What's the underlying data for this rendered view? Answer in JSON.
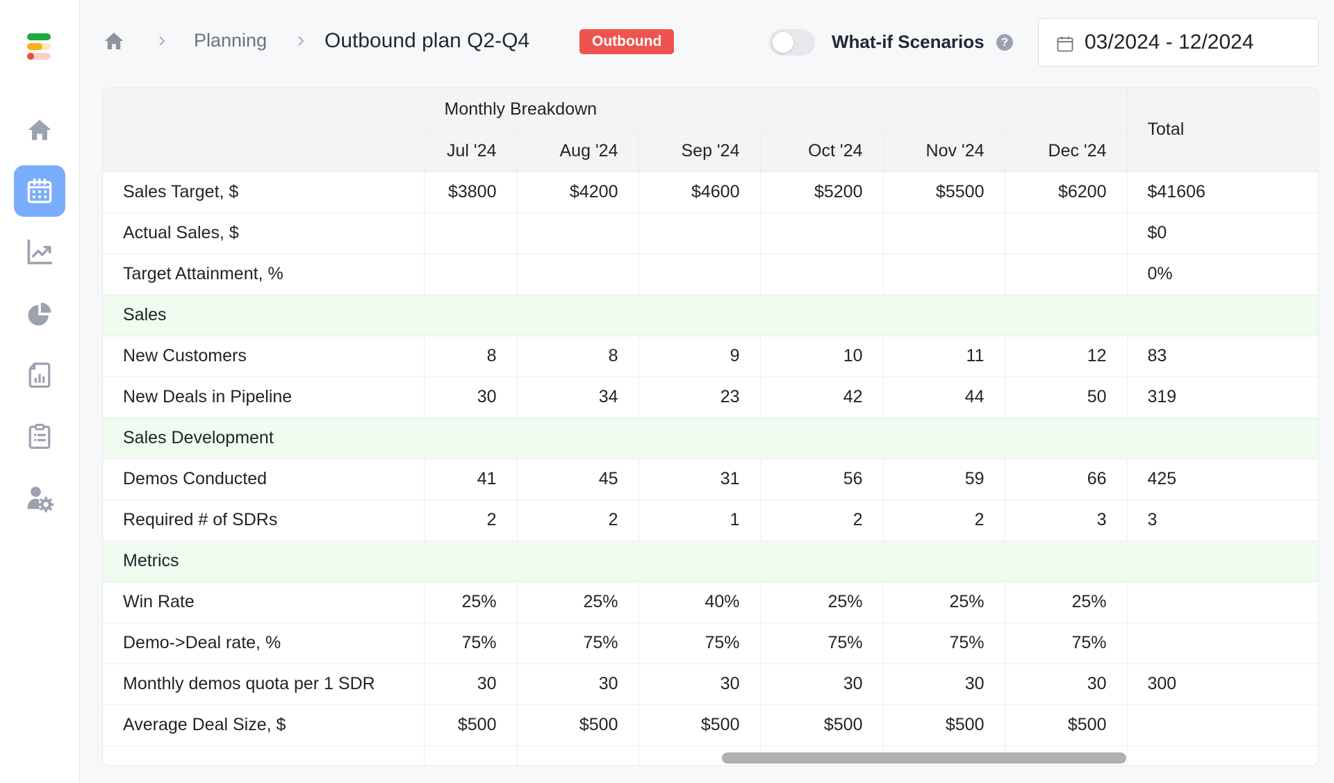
{
  "sidebar": {
    "logo": "app-logo",
    "items": [
      {
        "name": "home",
        "icon": "home-icon",
        "active": false
      },
      {
        "name": "planning",
        "icon": "calendar-icon",
        "active": true
      },
      {
        "name": "analytics",
        "icon": "line-chart-icon",
        "active": false
      },
      {
        "name": "reports",
        "icon": "pie-chart-icon",
        "active": false
      },
      {
        "name": "documents",
        "icon": "document-chart-icon",
        "active": false
      },
      {
        "name": "tasks",
        "icon": "clipboard-list-icon",
        "active": false
      },
      {
        "name": "user-settings",
        "icon": "user-gear-icon",
        "active": false
      }
    ],
    "active_color": "#7aaefc"
  },
  "header": {
    "breadcrumb": {
      "home_icon": "home-icon",
      "parent": "Planning",
      "current": "Outbound plan Q2-Q4"
    },
    "badge": {
      "label": "Outbound",
      "color": "#ef5350"
    },
    "whatif": {
      "label": "What-if Scenarios",
      "enabled": false,
      "help": "?"
    },
    "date_range": "03/2024 - 12/2024"
  },
  "table": {
    "group_header": "Monthly Breakdown",
    "total_header": "Total",
    "months": [
      "Jul '24",
      "Aug '24",
      "Sep '24",
      "Oct '24",
      "Nov '24",
      "Dec '24"
    ],
    "rows": [
      {
        "type": "data",
        "label": "Sales Target, $",
        "values": [
          "$3800",
          "$4200",
          "$4600",
          "$5200",
          "$5500",
          "$6200"
        ],
        "total": "$41606"
      },
      {
        "type": "data",
        "label": "Actual Sales, $",
        "values": [
          "",
          "",
          "",
          "",
          "",
          ""
        ],
        "total": "$0"
      },
      {
        "type": "data",
        "label": "Target Attainment, %",
        "values": [
          "",
          "",
          "",
          "",
          "",
          ""
        ],
        "total": "0%"
      },
      {
        "type": "section",
        "label": "Sales"
      },
      {
        "type": "data",
        "label": "New Customers",
        "values": [
          "8",
          "8",
          "9",
          "10",
          "11",
          "12"
        ],
        "total": "83"
      },
      {
        "type": "data",
        "label": "New Deals in Pipeline",
        "values": [
          "30",
          "34",
          "23",
          "42",
          "44",
          "50"
        ],
        "total": "319"
      },
      {
        "type": "section",
        "label": "Sales Development"
      },
      {
        "type": "data",
        "label": "Demos Conducted",
        "values": [
          "41",
          "45",
          "31",
          "56",
          "59",
          "66"
        ],
        "total": "425"
      },
      {
        "type": "data",
        "label": "Required # of SDRs",
        "values": [
          "2",
          "2",
          "1",
          "2",
          "2",
          "3"
        ],
        "total": "3"
      },
      {
        "type": "section",
        "label": "Metrics"
      },
      {
        "type": "data",
        "label": "Win Rate",
        "values": [
          "25%",
          "25%",
          "40%",
          "25%",
          "25%",
          "25%"
        ],
        "total": ""
      },
      {
        "type": "data",
        "label": "Demo->Deal rate, %",
        "values": [
          "75%",
          "75%",
          "75%",
          "75%",
          "75%",
          "75%"
        ],
        "total": ""
      },
      {
        "type": "data",
        "label": "Monthly demos quota per 1 SDR",
        "values": [
          "30",
          "30",
          "30",
          "30",
          "30",
          "30"
        ],
        "total": "300"
      },
      {
        "type": "data",
        "label": "Average Deal Size, $",
        "values": [
          "$500",
          "$500",
          "$500",
          "$500",
          "$500",
          "$500"
        ],
        "total": ""
      }
    ],
    "section_color": "#effcef"
  }
}
